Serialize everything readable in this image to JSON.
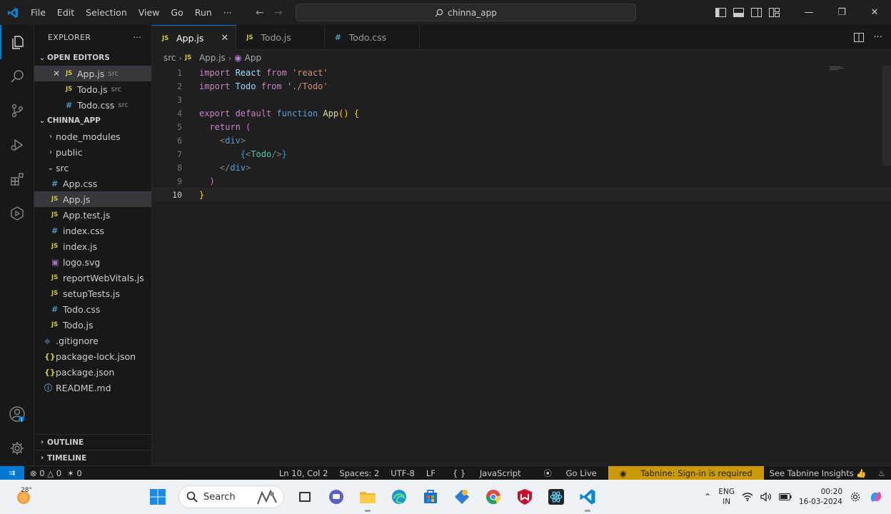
{
  "titlebar": {
    "menu": [
      "File",
      "Edit",
      "Selection",
      "View",
      "Go",
      "Run",
      "···"
    ],
    "search_text": "chinna_app"
  },
  "sidebar": {
    "title": "EXPLORER",
    "more": "···",
    "open_editors_label": "OPEN EDITORS",
    "open_editors": [
      {
        "name": "App.js",
        "desc": "src",
        "icon": "js",
        "selected": true,
        "close": true
      },
      {
        "name": "Todo.js",
        "desc": "src",
        "icon": "js"
      },
      {
        "name": "Todo.css",
        "desc": "src",
        "icon": "css"
      }
    ],
    "project_label": "CHINNA_APP",
    "tree": [
      {
        "name": "node_modules",
        "type": "folder",
        "indent": 0,
        "open": false
      },
      {
        "name": "public",
        "type": "folder",
        "indent": 0,
        "open": false
      },
      {
        "name": "src",
        "type": "folder",
        "indent": 0,
        "open": true
      },
      {
        "name": "App.css",
        "type": "css",
        "indent": 1
      },
      {
        "name": "App.js",
        "type": "js",
        "indent": 1,
        "selected": true
      },
      {
        "name": "App.test.js",
        "type": "js",
        "indent": 1
      },
      {
        "name": "index.css",
        "type": "css",
        "indent": 1
      },
      {
        "name": "index.js",
        "type": "js",
        "indent": 1
      },
      {
        "name": "logo.svg",
        "type": "svg",
        "indent": 1
      },
      {
        "name": "reportWebVitals.js",
        "type": "js",
        "indent": 1
      },
      {
        "name": "setupTests.js",
        "type": "js",
        "indent": 1
      },
      {
        "name": "Todo.css",
        "type": "css",
        "indent": 1
      },
      {
        "name": "Todo.js",
        "type": "js",
        "indent": 1
      },
      {
        "name": ".gitignore",
        "type": "git",
        "indent": 0
      },
      {
        "name": "package-lock.json",
        "type": "json",
        "indent": 0
      },
      {
        "name": "package.json",
        "type": "json",
        "indent": 0
      },
      {
        "name": "README.md",
        "type": "info",
        "indent": 0
      }
    ],
    "outline_label": "OUTLINE",
    "timeline_label": "TIMELINE"
  },
  "editor": {
    "tabs": [
      {
        "name": "App.js",
        "icon": "js",
        "active": true
      },
      {
        "name": "Todo.js",
        "icon": "js",
        "active": false
      },
      {
        "name": "Todo.css",
        "icon": "css",
        "active": false
      }
    ],
    "breadcrumb": {
      "folder": "src",
      "file": "App.js",
      "symbol": "App"
    },
    "current_line": 10,
    "lines": [
      [
        {
          "t": "import ",
          "c": "kw"
        },
        {
          "t": "React ",
          "c": "id"
        },
        {
          "t": "from ",
          "c": "kw"
        },
        {
          "t": "'react'",
          "c": "str"
        }
      ],
      [
        {
          "t": "import ",
          "c": "kw"
        },
        {
          "t": "Todo ",
          "c": "id"
        },
        {
          "t": "from ",
          "c": "kw"
        },
        {
          "t": "'./Todo'",
          "c": "str"
        }
      ],
      [],
      [
        {
          "t": "export ",
          "c": "kw"
        },
        {
          "t": "default ",
          "c": "kw"
        },
        {
          "t": "function ",
          "c": "kw2"
        },
        {
          "t": "App",
          "c": "fn"
        },
        {
          "t": "() ",
          "c": "br1"
        },
        {
          "t": "{",
          "c": "br1"
        }
      ],
      [
        {
          "t": "  return ",
          "c": "kw"
        },
        {
          "t": "(",
          "c": "br2"
        }
      ],
      [
        {
          "t": "    <",
          "c": "tag"
        },
        {
          "t": "div",
          "c": "tagn"
        },
        {
          "t": ">",
          "c": "tag"
        }
      ],
      [
        {
          "t": "        ",
          "c": "pl"
        },
        {
          "t": "{",
          "c": "br3"
        },
        {
          "t": "<",
          "c": "tag"
        },
        {
          "t": "Todo",
          "c": "comp"
        },
        {
          "t": "/>",
          "c": "tag"
        },
        {
          "t": "}",
          "c": "br3"
        }
      ],
      [
        {
          "t": "    </",
          "c": "tag"
        },
        {
          "t": "div",
          "c": "tagn"
        },
        {
          "t": ">",
          "c": "tag"
        }
      ],
      [
        {
          "t": "  )",
          "c": "br2"
        }
      ],
      [
        {
          "t": "}",
          "c": "br1"
        }
      ]
    ]
  },
  "statusbar": {
    "errors": "0",
    "warnings": "0",
    "ports": "0",
    "position": "Ln 10, Col 2",
    "spaces": "Spaces: 2",
    "encoding": "UTF-8",
    "eol": "LF",
    "language": "JavaScript",
    "golive": "Go Live",
    "tabnine": "Tabnine: Sign-in is required",
    "insights": "See Tabnine Insights 👍"
  },
  "taskbar": {
    "temp": "28°",
    "search": "Search",
    "lang_top": "ENG",
    "lang_bottom": "IN",
    "time": "00:20",
    "date": "16-03-2024"
  },
  "colors": {
    "accent": "#0078d4",
    "warning_bg": "#cc9a06",
    "js_icon": "#cbcb41",
    "css_icon": "#519aba"
  }
}
